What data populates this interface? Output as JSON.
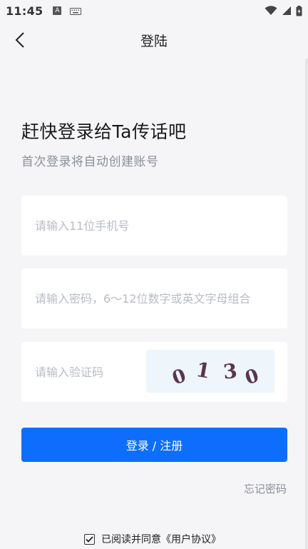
{
  "status_bar": {
    "time": "11:45",
    "a_label": "A",
    "icons": [
      "wifi-icon",
      "cell-signal-icon",
      "battery-icon"
    ]
  },
  "header": {
    "title": "登陆",
    "back_icon": "chevron-left-icon"
  },
  "hero": {
    "heading": "赶快登录给Ta传话吧",
    "subheading": "首次登录将自动创建账号"
  },
  "form": {
    "phone_placeholder": "请输入11位手机号",
    "password_placeholder": "请输入密码，6～12位数字或英文字母组合",
    "code_placeholder": "请输入验证码",
    "captcha_text": "0130",
    "captcha_chars": [
      "0",
      "1",
      "3",
      "0"
    ]
  },
  "actions": {
    "login_label": "登录 / 注册",
    "forgot_label": "忘记密码"
  },
  "agreement": {
    "checked": true,
    "label": "已阅读并同意《用户协议》"
  },
  "colors": {
    "primary": "#0d6efd",
    "background": "#f5f5f7",
    "muted_text": "#8a8f99",
    "captcha_ink": "#5a3550"
  }
}
